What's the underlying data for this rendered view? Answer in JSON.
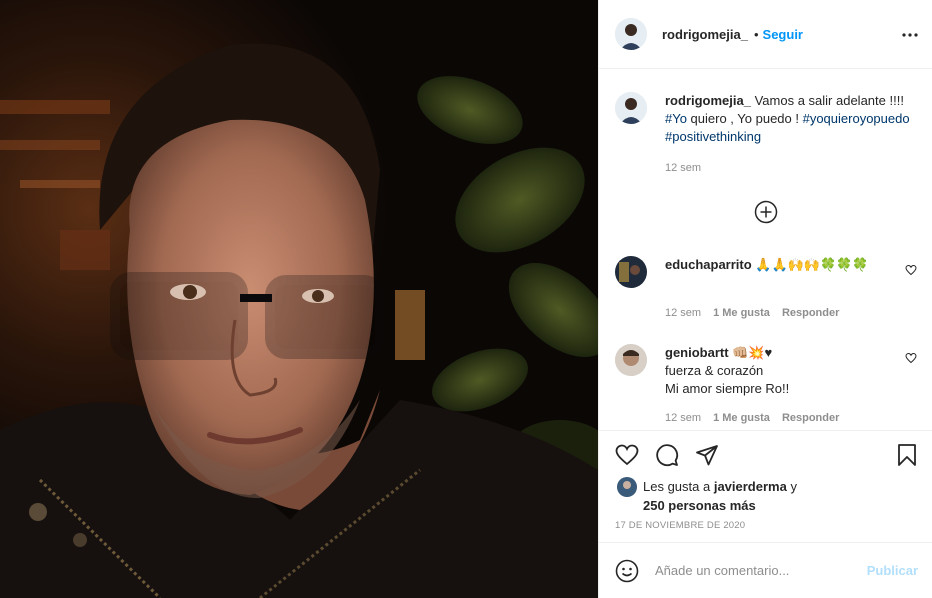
{
  "post": {
    "username": "rodrigomejia_",
    "follow_label": "Seguir",
    "separator": "•",
    "more_label": "•••"
  },
  "caption": {
    "username": "rodrigomejia_",
    "text_1": "Vamos a salir adelante !!!! ",
    "tag_1": "#Yo",
    "text_2": " quiero , Yo puedo ! ",
    "tag_2": "#yoquieroyopuedo",
    "text_3": " ",
    "tag_3": "#positivethinking",
    "time": "12 sem"
  },
  "comments": [
    {
      "username": "educhaparrito",
      "text": "🙏🙏🙌🙌🍀🍀🍀",
      "time": "12 sem",
      "likes": "1 Me gusta",
      "reply": "Responder"
    },
    {
      "username": "geniobartt",
      "text_1": "👊🏼💥♥",
      "text_2": "fuerza & corazón",
      "text_3": "Mi amor siempre Ro!!",
      "time": "12 sem",
      "likes": "1 Me gusta",
      "reply": "Responder"
    }
  ],
  "likes": {
    "prefix": "Les gusta a ",
    "user": "javierderma",
    "suffix": " y",
    "others": "250 personas más"
  },
  "date": "17 DE NOVIEMBRE DE 2020",
  "add_comment": {
    "placeholder": "Añade un comentario...",
    "publish": "Publicar"
  },
  "icons": {
    "more": "more-options-icon",
    "load_more": "plus-circle-icon",
    "like": "heart-icon",
    "comment": "comment-bubble-icon",
    "share": "paper-plane-icon",
    "save": "bookmark-icon",
    "emoji": "smiley-icon"
  },
  "colors": {
    "link": "#0095f6",
    "hashtag": "#00376b",
    "muted": "#8e8e8e",
    "publish_disabled": "#b2dffc"
  }
}
